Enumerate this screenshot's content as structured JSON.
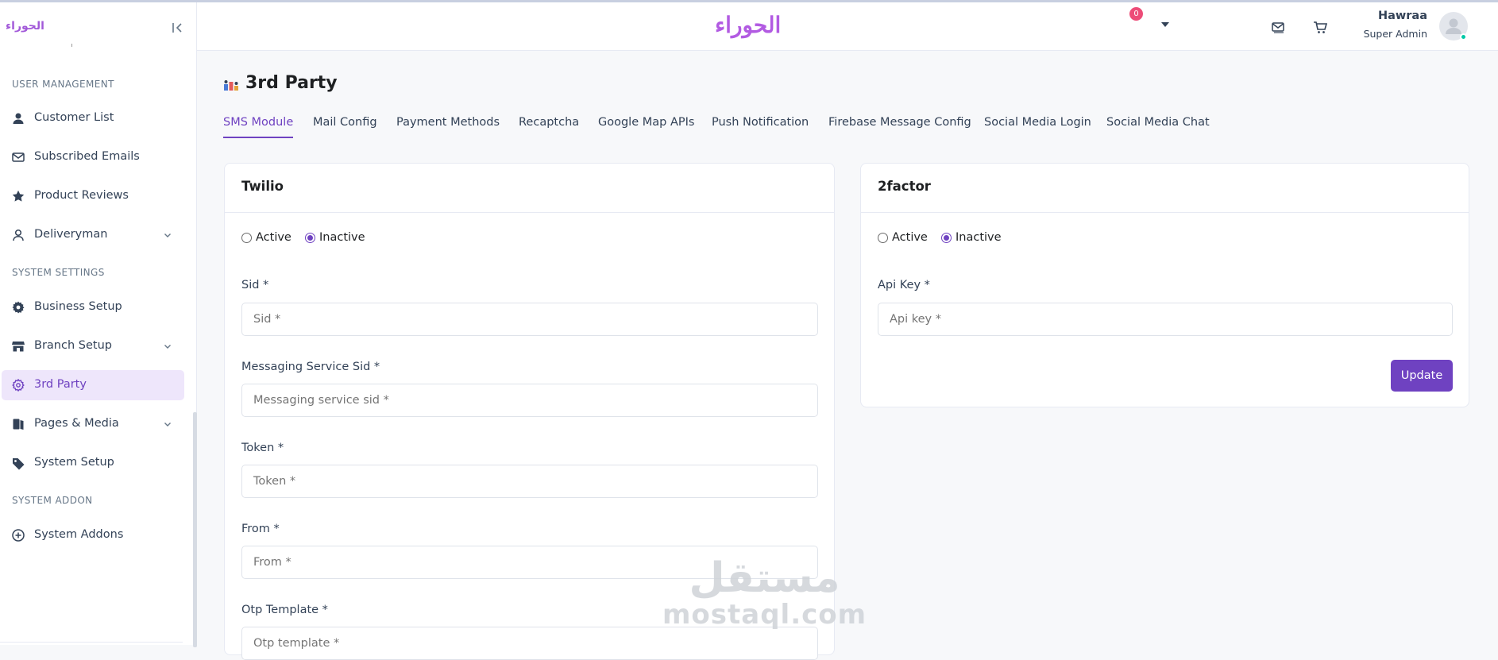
{
  "sidebar": {
    "logo": "الحوراء",
    "sections": {
      "user_management": "USER MANAGEMENT",
      "system_settings": "SYSTEM SETTINGS",
      "system_addon": "SYSTEM ADDON"
    },
    "items": [
      {
        "label": "Customer List",
        "icon": "user-icon"
      },
      {
        "label": "Subscribed Emails",
        "icon": "mail-icon"
      },
      {
        "label": "Product Reviews",
        "icon": "star-icon"
      },
      {
        "label": "Deliveryman",
        "icon": "person-icon",
        "has_submenu": true
      },
      {
        "label": "Business Setup",
        "icon": "gear-icon"
      },
      {
        "label": "Branch Setup",
        "icon": "store-icon",
        "has_submenu": true
      },
      {
        "label": "3rd Party",
        "icon": "settings-icon",
        "active": true
      },
      {
        "label": "Pages & Media",
        "icon": "book-icon",
        "has_submenu": true
      },
      {
        "label": "System Setup",
        "icon": "tag-icon"
      },
      {
        "label": "System Addons",
        "icon": "plus-circle-icon"
      }
    ]
  },
  "header": {
    "logo": "الحوراء",
    "cart_count": "0",
    "user_name": "Hawraa",
    "user_role": "Super Admin"
  },
  "page": {
    "title": "3rd Party",
    "tabs": [
      {
        "label": "SMS Module",
        "active": true
      },
      {
        "label": "Mail Config"
      },
      {
        "label": "Payment Methods"
      },
      {
        "label": "Recaptcha"
      },
      {
        "label": "Google Map APIs"
      },
      {
        "label": "Push Notification"
      },
      {
        "label": "Firebase Message Config"
      },
      {
        "label": "Social Media Login"
      },
      {
        "label": "Social Media Chat"
      }
    ]
  },
  "twilio": {
    "title": "Twilio",
    "active_label": "Active",
    "inactive_label": "Inactive",
    "status": "inactive",
    "fields": [
      {
        "label": "Sid *",
        "placeholder": "Sid *"
      },
      {
        "label": "Messaging Service Sid *",
        "placeholder": "Messaging service sid *"
      },
      {
        "label": "Token *",
        "placeholder": "Token *"
      },
      {
        "label": "From *",
        "placeholder": "From *"
      },
      {
        "label": "Otp Template *",
        "placeholder": "Otp template *"
      }
    ]
  },
  "twofactor": {
    "title": "2factor",
    "active_label": "Active",
    "inactive_label": "Inactive",
    "status": "inactive",
    "api_key_label": "Api Key *",
    "api_key_placeholder": "Api key *",
    "update_label": "Update"
  },
  "watermark": {
    "arabic": "مستقل",
    "latin": "mostaql.com"
  },
  "colors": {
    "accent": "#6f42c1",
    "active_bg": "#eee6fb",
    "badge": "#ed4c78",
    "online": "#00c9a7",
    "logo": "#b25be2"
  }
}
